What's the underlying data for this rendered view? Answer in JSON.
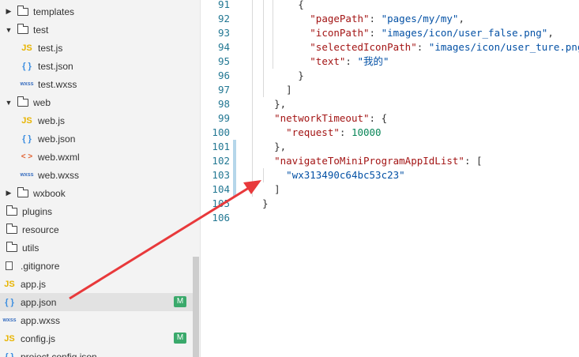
{
  "sidebar": {
    "items": [
      {
        "label": "templates",
        "kind": "folder",
        "state": "closed"
      },
      {
        "label": "test",
        "kind": "folder",
        "state": "open"
      },
      {
        "label": "test.js",
        "kind": "js",
        "icon_text": "JS"
      },
      {
        "label": "test.json",
        "kind": "json",
        "icon_text": "{ }"
      },
      {
        "label": "test.wxss",
        "kind": "wxss",
        "icon_text": "wxss"
      },
      {
        "label": "web",
        "kind": "folder",
        "state": "open"
      },
      {
        "label": "web.js",
        "kind": "js",
        "icon_text": "JS"
      },
      {
        "label": "web.json",
        "kind": "json",
        "icon_text": "{ }"
      },
      {
        "label": "web.wxml",
        "kind": "wxml",
        "icon_text": "< >"
      },
      {
        "label": "web.wxss",
        "kind": "wxss",
        "icon_text": "wxss"
      },
      {
        "label": "wxbook",
        "kind": "folder",
        "state": "closed"
      },
      {
        "label": "plugins",
        "kind": "folder",
        "state": "closed"
      },
      {
        "label": "resource",
        "kind": "folder",
        "state": "closed"
      },
      {
        "label": "utils",
        "kind": "folder",
        "state": "closed"
      },
      {
        "label": ".gitignore",
        "kind": "file"
      },
      {
        "label": "app.js",
        "kind": "js",
        "icon_text": "JS"
      },
      {
        "label": "app.json",
        "kind": "json",
        "icon_text": "{ }",
        "badge": "M"
      },
      {
        "label": "app.wxss",
        "kind": "wxss",
        "icon_text": "wxss"
      },
      {
        "label": "config.js",
        "kind": "js",
        "icon_text": "JS",
        "badge": "M"
      },
      {
        "label": "project.config.json",
        "kind": "json",
        "icon_text": "{ }"
      }
    ],
    "selected": "app.json"
  },
  "editor": {
    "lines": [
      {
        "n": "91",
        "text": "        {"
      },
      {
        "n": "92",
        "text": "          \"pagePath\": \"pages/my/my\","
      },
      {
        "n": "93",
        "text": "          \"iconPath\": \"images/icon/user_false.png\","
      },
      {
        "n": "94",
        "text": "          \"selectedIconPath\": \"images/icon/user_ture.png\""
      },
      {
        "n": "95",
        "text": "          \"text\": \"我的\""
      },
      {
        "n": "96",
        "text": "        }"
      },
      {
        "n": "97",
        "text": "      ]"
      },
      {
        "n": "98",
        "text": "    },"
      },
      {
        "n": "99",
        "text": "    \"networkTimeout\": {"
      },
      {
        "n": "100",
        "text": "      \"request\": 10000"
      },
      {
        "n": "101",
        "text": "    },"
      },
      {
        "n": "102",
        "text": "    \"navigateToMiniProgramAppIdList\": ["
      },
      {
        "n": "103",
        "text": "      \"wx313490c64bc53c23\""
      },
      {
        "n": "104",
        "text": "    ]"
      },
      {
        "n": "105",
        "text": "  }"
      },
      {
        "n": "106",
        "text": ""
      }
    ]
  },
  "annotation": {
    "color": "#e8393b"
  }
}
